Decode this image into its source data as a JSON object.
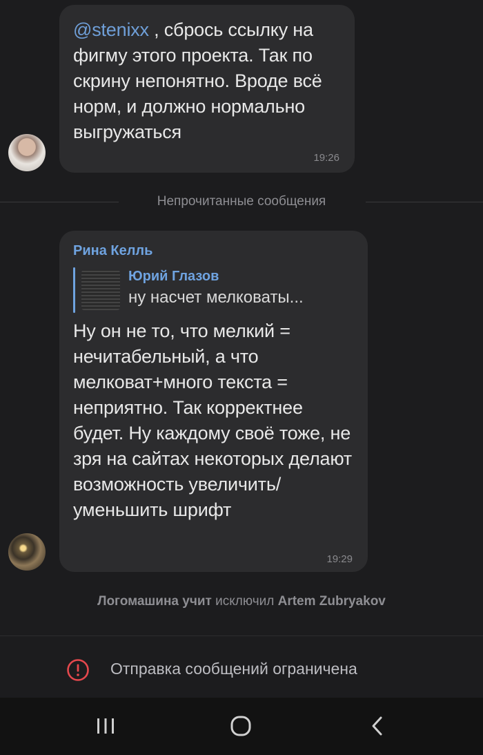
{
  "messages": [
    {
      "mention": "@stenixx",
      "text": " , сбрось ссылку на фигму этого проекта. Так по скрину непонятно. Вроде всё норм, и должно нормально выгружаться",
      "time": "19:26"
    },
    {
      "sender": "Рина Келль",
      "reply": {
        "name": "Юрий Глазов",
        "text": "ну насчет мелковаты..."
      },
      "text": "Ну он не то, что мелкий = нечитабельный, а что мелковат+много текста = неприятно. Так корректнее будет. Ну каждому своё тоже, не зря на сайтах некоторых делают возможность увеличить/ уменьшить шрифт",
      "time": "19:29"
    }
  ],
  "unread_divider": "Непрочитанные сообщения",
  "service_message": {
    "actor": "Логомашина учит",
    "action": "исключил",
    "target": "Artem Zubryakov"
  },
  "restricted_notice": "Отправка сообщений ограничена",
  "colors": {
    "background": "#1c1c1e",
    "bubble": "#2c2c2e",
    "accent": "#6fa3e0",
    "warning": "#e5484d"
  },
  "icons": {
    "restricted": "alert-circle-icon",
    "nav_recent": "recent-apps-icon",
    "nav_home": "home-icon",
    "nav_back": "back-icon"
  }
}
